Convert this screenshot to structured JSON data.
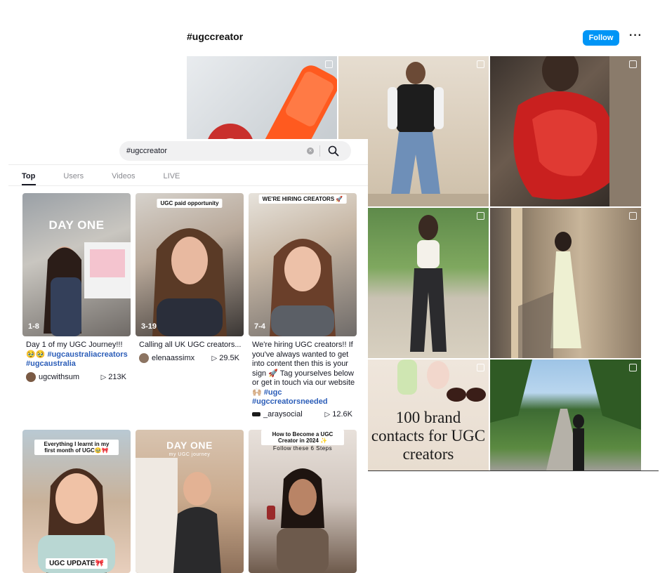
{
  "instagram": {
    "title": "#ugccreator",
    "follow_label": "Follow",
    "more_label": "···",
    "overlay_text": "100 brand contacts for UGC creators"
  },
  "tiktok": {
    "search": {
      "query": "#ugccreator"
    },
    "tabs": [
      {
        "label": "Top",
        "active": true
      },
      {
        "label": "Users",
        "active": false
      },
      {
        "label": "Videos",
        "active": false
      },
      {
        "label": "LIVE",
        "active": false
      }
    ],
    "videos": [
      {
        "overlay": "DAY ONE",
        "count": "1-8",
        "caption": "Day 1 of my UGC Journey!!! 🥹🥹",
        "tags": "#ugcaustraliacreators #ugcaustralia",
        "author": "ugcwithsum",
        "views": "213K"
      },
      {
        "overlay": "UGC paid opportunity",
        "count": "3-19",
        "caption": "Calling all UK UGC creators...",
        "tags": "",
        "author": "elenaassimx",
        "views": "29.5K"
      },
      {
        "overlay": "WE'RE HIRING CREATORS 🚀",
        "count": "7-4",
        "caption": "We're hiring UGC creators!! If you've always wanted to get into content then this is your sign 🚀 Tag yourselves below or get in touch via our website 🙌🏼",
        "tags": "#ugc #ugccreatorsneeded",
        "author": "_araysocial",
        "views": "12.6K"
      },
      {
        "overlay": "Everything I learnt in my first month of UGC🥹🎀",
        "bottom": "UGC UPDATE🎀"
      },
      {
        "overlay": "DAY ONE",
        "sub": "my UGC journey"
      },
      {
        "overlay": "How to Become a UGC Creator in 2024 ✨",
        "sub": "Follow these 6 Steps"
      }
    ]
  },
  "colors": {
    "accent_blue": "#0095f6",
    "hashtag": "#2b5db8"
  }
}
